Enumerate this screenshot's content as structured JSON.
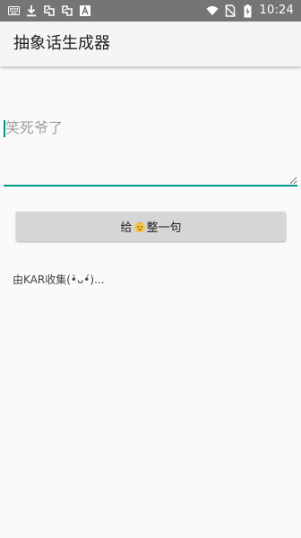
{
  "status_bar": {
    "time": "10:24",
    "left_icons": [
      "keyboard-icon",
      "download-icon",
      "app-bug-icon",
      "app-bug-icon",
      "font-icon"
    ],
    "right_icons": [
      "wifi-icon",
      "no-sim-icon",
      "battery-charging-icon"
    ]
  },
  "app_bar": {
    "title": "抽象话生成器"
  },
  "input": {
    "placeholder": "笑死爷了",
    "value": ""
  },
  "generate_button": {
    "label_before": "给",
    "icon": "baby-face-emoji-icon",
    "label_after": "整一句"
  },
  "credit": {
    "text": "由KAR收集(•̀ᴗ•́)..."
  },
  "colors": {
    "status_bar_bg": "#757575",
    "app_bar_bg": "#f5f5f5",
    "accent": "#009688",
    "button_bg": "#d6d6d6",
    "page_bg": "#fafafa"
  }
}
